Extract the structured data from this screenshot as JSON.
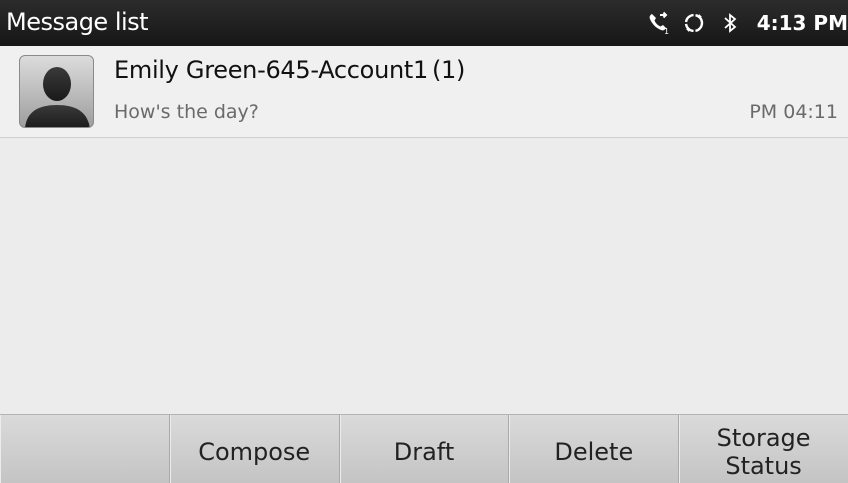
{
  "statusbar": {
    "title": "Message list",
    "clock": "4:13 PM",
    "icons": [
      "call-forward-icon",
      "sync-icon",
      "bluetooth-icon"
    ]
  },
  "messages": [
    {
      "name": "Emily Green-645-Account1",
      "count": "(1)",
      "preview": "How's the day?",
      "time": "PM 04:11"
    }
  ],
  "softkeys": [
    "",
    "Compose",
    "Draft",
    "Delete",
    "Storage Status"
  ],
  "colors": {
    "statusbar_bg": "#1e1e1e",
    "list_bg": "#ececec",
    "softkey_bg": "#cfcfcf"
  }
}
